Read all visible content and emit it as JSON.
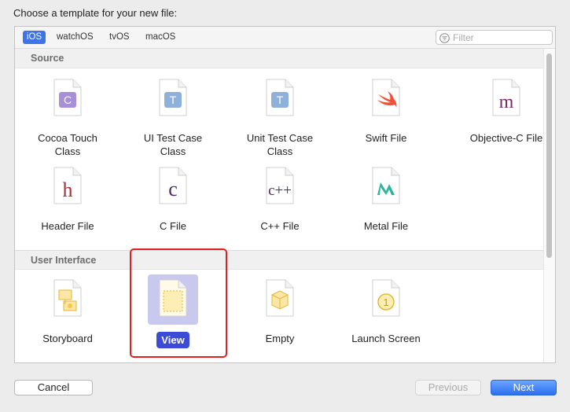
{
  "dialog": {
    "prompt": "Choose a template for your new file:"
  },
  "platforms": {
    "tabs": [
      "iOS",
      "watchOS",
      "tvOS",
      "macOS"
    ],
    "selected": "iOS"
  },
  "filter": {
    "placeholder": "Filter"
  },
  "sections": [
    {
      "title": "Source",
      "templates": [
        {
          "line1": "Cocoa Touch",
          "line2": "Class",
          "icon": "cocoa-touch-class-icon"
        },
        {
          "line1": "UI Test Case",
          "line2": "Class",
          "icon": "ui-test-case-class-icon"
        },
        {
          "line1": "Unit Test Case",
          "line2": "Class",
          "icon": "unit-test-case-class-icon"
        },
        {
          "line1": "Swift File",
          "line2": "",
          "icon": "swift-file-icon"
        },
        {
          "line1": "Objective-C File",
          "line2": "",
          "icon": "objective-c-file-icon"
        },
        {
          "line1": "Header File",
          "line2": "",
          "icon": "header-file-icon"
        },
        {
          "line1": "C File",
          "line2": "",
          "icon": "c-file-icon"
        },
        {
          "line1": "C++ File",
          "line2": "",
          "icon": "cpp-file-icon"
        },
        {
          "line1": "Metal File",
          "line2": "",
          "icon": "metal-file-icon"
        }
      ]
    },
    {
      "title": "User Interface",
      "templates": [
        {
          "line1": "Storyboard",
          "icon": "storyboard-icon"
        },
        {
          "line1": "View",
          "icon": "view-icon",
          "selected": true
        },
        {
          "line1": "Empty",
          "icon": "empty-icon"
        },
        {
          "line1": "Launch Screen",
          "icon": "launch-screen-icon"
        }
      ]
    }
  ],
  "glyphs": {
    "c": "C",
    "t": "T",
    "m": "m",
    "h": "h",
    "clower": "c",
    "cpp": "c++",
    "one": "1"
  },
  "buttons": {
    "cancel": "Cancel",
    "previous": "Previous",
    "next": "Next"
  },
  "colors": {
    "accent": "#3f74e6",
    "selection": "#3b4bd8",
    "highlight_outline": "#e02020",
    "objc_purple": "#7a2a6a",
    "swift_orange": "#f05138",
    "metal_teal": "#2bb59a",
    "storyboard_yellow": "#f2c94c"
  }
}
